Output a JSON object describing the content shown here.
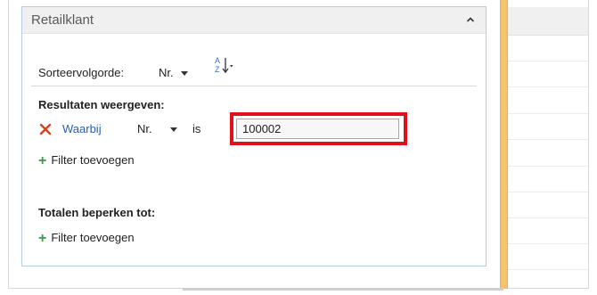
{
  "panel": {
    "title": "Retailklant"
  },
  "sort": {
    "label": "Sorteervolgorde:",
    "field": "Nr.",
    "direction_label": "AZ"
  },
  "show_results": {
    "heading": "Resultaten weergeven:",
    "filter": {
      "name": "Waarbij",
      "field": "Nr.",
      "operator": "is",
      "value": "100002"
    },
    "add_filter_label": "Filter toevoegen"
  },
  "limit_totals": {
    "heading": "Totalen beperken tot:",
    "add_filter_label": "Filter toevoegen"
  },
  "colors": {
    "accent_orange": "#f4c36b",
    "highlight_red": "#e3101b",
    "link_blue": "#2a5db0",
    "plus_green": "#3a9a49",
    "remove_red": "#d9401c"
  },
  "icons": {
    "collapse": "chevron-up-icon",
    "remove": "close-icon",
    "add": "plus-icon",
    "sort": "sort-ascending-icon"
  }
}
